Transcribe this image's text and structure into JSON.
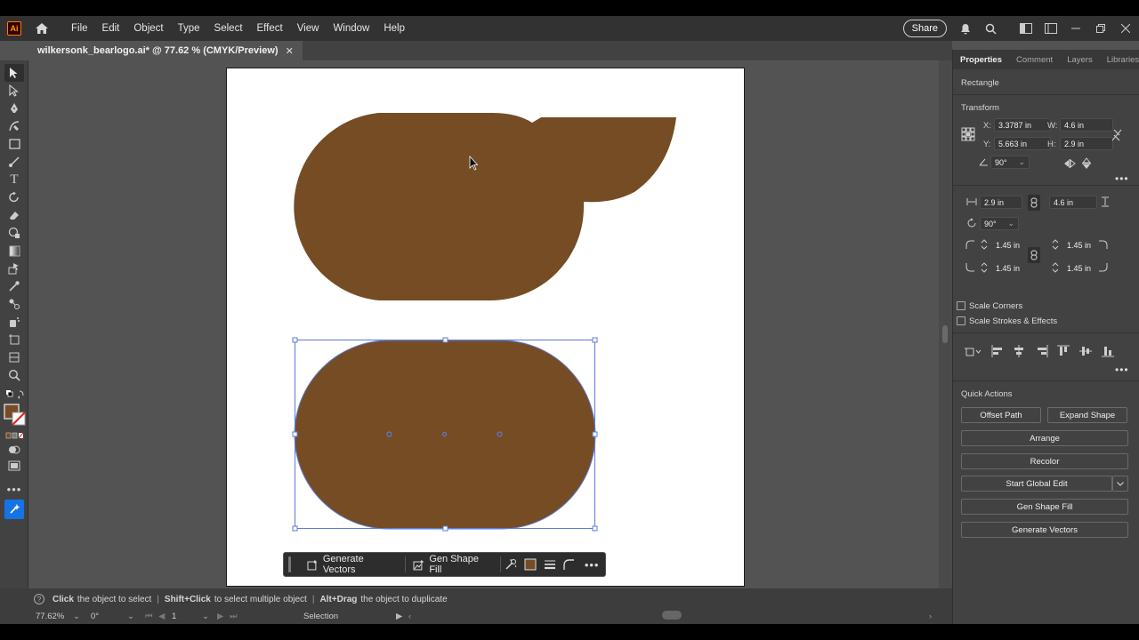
{
  "app": {
    "logo_text": "Ai",
    "menu": [
      "File",
      "Edit",
      "Object",
      "Type",
      "Select",
      "Effect",
      "View",
      "Window",
      "Help"
    ],
    "share_label": "Share"
  },
  "document": {
    "tab_title": "wilkersonk_bearlogo.ai* @ 77.62 % (CMYK/Preview)",
    "close_glyph": "✕"
  },
  "colors": {
    "shape_fill": "#754c24",
    "selection": "#5b7bd5"
  },
  "context_bar": {
    "generate_vectors": "Generate Vectors",
    "gen_shape_fill": "Gen Shape Fill"
  },
  "status": {
    "hint_1_bold": "Click",
    "hint_1": "the object to select",
    "hint_2_bold": "Shift+Click",
    "hint_2": "to select multiple object",
    "hint_3_bold": "Alt+Drag",
    "hint_3": "the object to duplicate",
    "zoom": "77.62%",
    "rotation": "0°",
    "artboard_num": "1",
    "tool_name": "Selection"
  },
  "panel": {
    "tabs": [
      "Properties",
      "Comment",
      "Layers",
      "Libraries"
    ],
    "object_type": "Rectangle",
    "transform_label": "Transform",
    "x_label": "X:",
    "x_value": "3.3787 in",
    "y_label": "Y:",
    "y_value": "5.663 in",
    "w_label": "W:",
    "w_value": "4.6 in",
    "h_label": "H:",
    "h_value": "2.9 in",
    "angle": "90°",
    "rect_width": "2.9 in",
    "rect_height": "4.6 in",
    "rect_angle": "90°",
    "corner_tl": "1.45 in",
    "corner_tr": "1.45 in",
    "corner_bl": "1.45 in",
    "corner_br": "1.45 in",
    "scale_corners": "Scale Corners",
    "scale_strokes": "Scale Strokes & Effects",
    "quick_actions": "Quick Actions",
    "offset_path": "Offset Path",
    "expand_shape": "Expand Shape",
    "arrange": "Arrange",
    "recolor": "Recolor",
    "start_global_edit": "Start Global Edit",
    "gen_shape_fill": "Gen Shape Fill",
    "generate_vectors": "Generate Vectors"
  }
}
